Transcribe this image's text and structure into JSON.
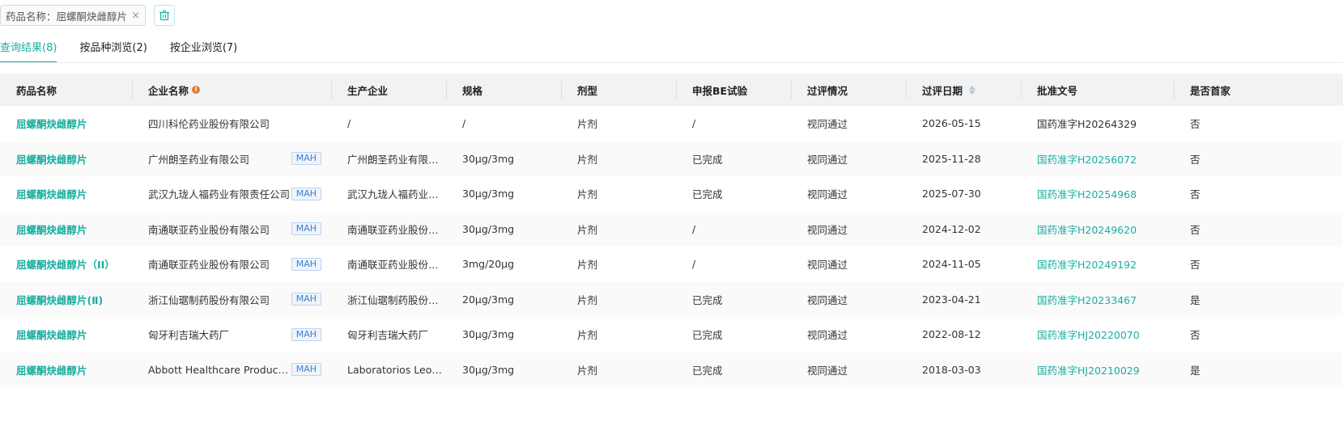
{
  "filter": {
    "tag_label": "药品名称：屈螺酮炔雌醇片",
    "close_glyph": "×",
    "clear_icon": "trash-icon"
  },
  "tabs": [
    {
      "label": "查询结果(8)",
      "active": true
    },
    {
      "label": "按品种浏览(2)",
      "active": false
    },
    {
      "label": "按企业浏览(7)",
      "active": false
    }
  ],
  "table": {
    "headers": [
      "药品名称",
      "企业名称",
      "生产企业",
      "规格",
      "剂型",
      "申报BE试验",
      "过评情况",
      "过评日期",
      "批准文号",
      "是否首家"
    ],
    "info_icon_glyph": "i",
    "rows": [
      {
        "drug": "屈螺酮炔雌醇片",
        "company": "四川科伦药业股份有限公司",
        "mah": "",
        "manufacturer": "/",
        "spec": "/",
        "form": "片剂",
        "be": "/",
        "status": "视同通过",
        "date": "2026-05-15",
        "approval": "国药准字H20264329",
        "approval_link": false,
        "first": "否"
      },
      {
        "drug": "屈螺酮炔雌醇片",
        "company": "广州朗圣药业有限公司",
        "mah": "MAH",
        "manufacturer": "广州朗圣药业有限…",
        "spec": "30μg/3mg",
        "form": "片剂",
        "be": "已完成",
        "status": "视同通过",
        "date": "2025-11-28",
        "approval": "国药准字H20256072",
        "approval_link": true,
        "first": "否"
      },
      {
        "drug": "屈螺酮炔雌醇片",
        "company": "武汉九珑人福药业有限责任公司",
        "mah": "MAH",
        "manufacturer": "武汉九珑人福药业…",
        "spec": "30μg/3mg",
        "form": "片剂",
        "be": "已完成",
        "status": "视同通过",
        "date": "2025-07-30",
        "approval": "国药准字H20254968",
        "approval_link": true,
        "first": "否"
      },
      {
        "drug": "屈螺酮炔雌醇片",
        "company": "南通联亚药业股份有限公司",
        "mah": "MAH",
        "manufacturer": "南通联亚药业股份…",
        "spec": "30μg/3mg",
        "form": "片剂",
        "be": "/",
        "status": "视同通过",
        "date": "2024-12-02",
        "approval": "国药准字H20249620",
        "approval_link": true,
        "first": "否"
      },
      {
        "drug": "屈螺酮炔雌醇片（II）",
        "company": "南通联亚药业股份有限公司",
        "mah": "MAH",
        "manufacturer": "南通联亚药业股份…",
        "spec": "3mg/20μg",
        "form": "片剂",
        "be": "/",
        "status": "视同通过",
        "date": "2024-11-05",
        "approval": "国药准字H20249192",
        "approval_link": true,
        "first": "否"
      },
      {
        "drug": "屈螺酮炔雌醇片(Ⅱ)",
        "company": "浙江仙琚制药股份有限公司",
        "mah": "MAH",
        "manufacturer": "浙江仙琚制药股份…",
        "spec": "20μg/3mg",
        "form": "片剂",
        "be": "已完成",
        "status": "视同通过",
        "date": "2023-04-21",
        "approval": "国药准字H20233467",
        "approval_link": true,
        "first": "是"
      },
      {
        "drug": "屈螺酮炔雌醇片",
        "company": "匈牙利吉瑞大药厂",
        "mah": "MAH",
        "manufacturer": "匈牙利吉瑞大药厂",
        "spec": "30μg/3mg",
        "form": "片剂",
        "be": "已完成",
        "status": "视同通过",
        "date": "2022-08-12",
        "approval": "国药准字HJ20220070",
        "approval_link": true,
        "first": "否"
      },
      {
        "drug": "屈螺酮炔雌醇片",
        "company": "Abbott Healthcare Products …",
        "mah": "MAH",
        "manufacturer": "Laboratorios Leo…",
        "spec": "30μg/3mg",
        "form": "片剂",
        "be": "已完成",
        "status": "视同通过",
        "date": "2018-03-03",
        "approval": "国药准字HJ20210029",
        "approval_link": true,
        "first": "是"
      }
    ]
  },
  "colors": {
    "accent": "#1aaea0",
    "mah_text": "#3f7fd1",
    "info_dot": "#e07b39",
    "header_bg": "#f0f2f3"
  }
}
